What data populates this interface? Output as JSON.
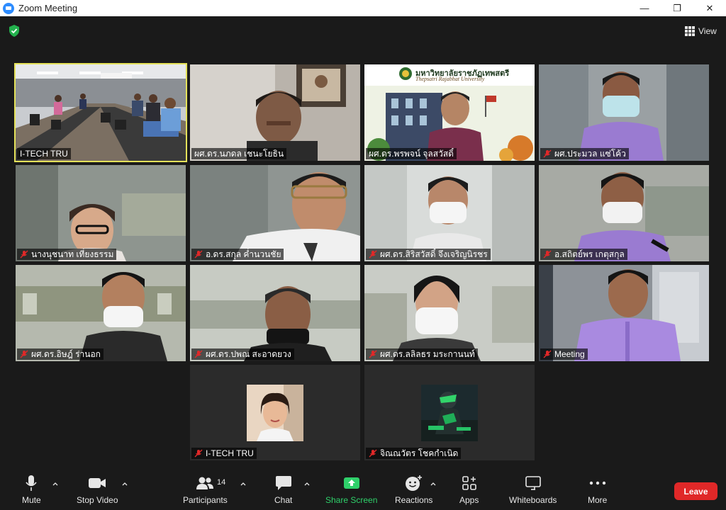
{
  "window": {
    "title": "Zoom Meeting",
    "minimize": "—",
    "maximize": "❐",
    "close": "✕"
  },
  "header": {
    "view_label": "View",
    "shield_icon": "shield-check-icon",
    "accent": "#e5e25a"
  },
  "participants": [
    {
      "name": "I-TECH TRU",
      "muted": false,
      "active": true
    },
    {
      "name": "ผศ.ดร.นภดล เชนะโยธิน",
      "muted": false,
      "active": false
    },
    {
      "name": "ผศ.ดร.พรพจน์ จุลสวัสดิ์",
      "muted": false,
      "active": false
    },
    {
      "name": "ผศ.ประมวล แซ่โค้ว",
      "muted": true,
      "active": false
    },
    {
      "name": "นางนุชนาท เที่ยงธรรม",
      "muted": true,
      "active": false
    },
    {
      "name": "อ.ดร.สกุล ค่ำนวนชัย",
      "muted": true,
      "active": false
    },
    {
      "name": "ผศ.ดร.สิริสวัสดิ์ จึงเจริญนิรชร",
      "muted": true,
      "active": false
    },
    {
      "name": "อ.สถิตย์พร เกตุสกุล",
      "muted": true,
      "active": false
    },
    {
      "name": "ผศ.ดร.อิษฎ์ ร่านอก",
      "muted": true,
      "active": false
    },
    {
      "name": "ผศ.ดร.ปพณ สะอาดยวง",
      "muted": true,
      "active": false
    },
    {
      "name": "ผศ.ดร.ลลิลธร มระกานนท์",
      "muted": true,
      "active": false
    },
    {
      "name": "Meeting",
      "muted": true,
      "active": false
    },
    {
      "name": "I-TECH TRU",
      "muted": true,
      "active": false
    },
    {
      "name": "จิณณวัตร โชคกำเนิด",
      "muted": true,
      "active": false
    }
  ],
  "banner": {
    "university_th": "มหาวิทยาลัยราชภัฏเทพสตรี",
    "university_en": "Thepsatri Rajabhat University"
  },
  "toolbar": {
    "mute": "Mute",
    "stop_video": "Stop Video",
    "participants": "Participants",
    "participants_count": "14",
    "chat": "Chat",
    "share_screen": "Share Screen",
    "reactions": "Reactions",
    "apps": "Apps",
    "whiteboards": "Whiteboards",
    "more": "More",
    "leave": "Leave",
    "share_color": "#2fd06a",
    "leave_color": "#e02828"
  }
}
